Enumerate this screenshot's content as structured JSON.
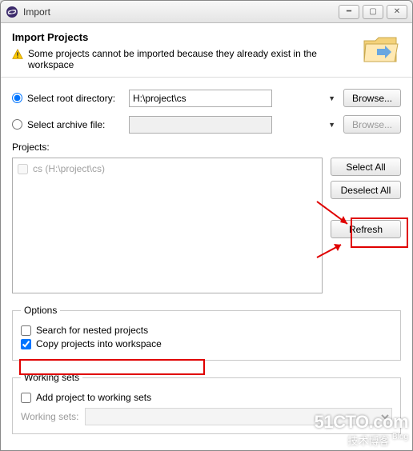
{
  "window": {
    "title": "Import"
  },
  "header": {
    "title": "Import Projects",
    "warning": "Some projects cannot be imported because they already exist in the workspace"
  },
  "source": {
    "root_label": "Select root directory:",
    "root_value": "H:\\project\\cs",
    "archive_label": "Select archive file:",
    "archive_value": "",
    "browse": "Browse..."
  },
  "projects": {
    "label": "Projects:",
    "items": [
      {
        "label": "cs (H:\\project\\cs)",
        "checked": false,
        "disabled": true
      }
    ],
    "select_all": "Select All",
    "deselect_all": "Deselect All",
    "refresh": "Refresh"
  },
  "options": {
    "legend": "Options",
    "search_nested": "Search for nested projects",
    "copy_into_ws": "Copy projects into workspace"
  },
  "working_sets": {
    "legend": "Working sets",
    "add_label": "Add project to working sets",
    "row_label": "Working sets:"
  },
  "watermark": {
    "line1": "51CTO.com",
    "line2": "技术博客",
    "blog": "Blog"
  }
}
